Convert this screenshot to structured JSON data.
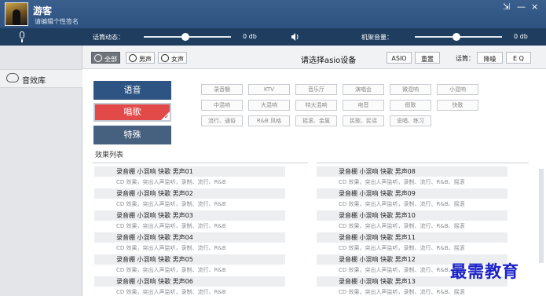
{
  "titlebar": {
    "username": "游客",
    "signature": "请编辑个性签名",
    "controls": {
      "shrink": "⇲",
      "minimize": "—",
      "close": "×"
    }
  },
  "controls": {
    "mic_label": "话筒动态：",
    "mic_value": "0 db",
    "mic_level": 0.48,
    "machine_label": "机架音量：",
    "machine_value": "0 db",
    "machine_level": 0.48
  },
  "sidebar": {
    "items": [
      {
        "label": "音效库",
        "icon": "cloud-icon"
      }
    ]
  },
  "filter": {
    "tabs": [
      {
        "label": "全部",
        "active": true
      },
      {
        "label": "男声",
        "active": false
      },
      {
        "label": "女声",
        "active": false
      }
    ],
    "prompt": "请选择asio设备",
    "asio_btn": "ASIO",
    "reset_btn": "重置",
    "mic_label": "话筒：",
    "noise_btn": "降噪",
    "eq_btn": "E Q"
  },
  "categories": [
    "语音",
    "唱歌",
    "特殊"
  ],
  "selected_category": "唱歌",
  "tags": [
    [
      "录音棚",
      "KTV",
      "音乐厅",
      "演唱会",
      "微混响",
      "小混响"
    ],
    [
      "中混响",
      "大混响",
      "特大混响",
      "电音",
      "假歌",
      "快歌"
    ],
    [
      "流行、通俗",
      "R&B 风格",
      "摇滚、金属",
      "民歌、民谣",
      "说唱、练习"
    ]
  ],
  "effects": {
    "title": "效果列表",
    "left": [
      {
        "title": "录音棚 小混响 快歌  男声01",
        "desc": "CD 效果，突出人声监听，录制、流行、R&B"
      },
      {
        "title": "录音棚 小混响 快歌  男声02",
        "desc": "CD 效果，突出人声监听，录制、流行、R&B"
      },
      {
        "title": "录音棚 小混响 快歌  男声03",
        "desc": "CD 效果，突出人声监听，录制、流行、R&B"
      },
      {
        "title": "录音棚 小混响 快歌  男声04",
        "desc": "CD 效果，突出人声监听，录制、流行、R&B"
      },
      {
        "title": "录音棚 小混响 快歌  男声05",
        "desc": "CD 效果，突出人声监听，录制、流行、R&B"
      },
      {
        "title": "录音棚 小混响 快歌  男声06",
        "desc": "CD 效果，突出人声监听，录制、流行、R&B"
      }
    ],
    "right": [
      {
        "title": "录音棚 小混响 快歌  男声08",
        "desc": "CD 效果，突出人声监听，录制、流行、R&B、摇滚"
      },
      {
        "title": "录音棚 小混响 快歌  男声09",
        "desc": "CD 效果，突出人声监听，录制、流行、R&B、摇滚"
      },
      {
        "title": "录音棚 小混响 快歌  男声10",
        "desc": "CD 效果，突出人声监听，录制、流行、R&B、摇滚"
      },
      {
        "title": "录音棚 小混响 快歌  男声11",
        "desc": "CD 效果，突出人声监听，录制、流行、R&B、摇滚"
      },
      {
        "title": "录音棚 小混响 快歌  男声12",
        "desc": "CD 效果，突出人声监听，录制、流行、R&B、摇滚"
      },
      {
        "title": "录音棚 小混响 快歌  男声13",
        "desc": "CD 效果，突出人声监听，录制、流行、R&B、摇滚"
      }
    ]
  },
  "watermark": "最需教育",
  "colors": {
    "titlebar": "#2d5280",
    "ctlbar": "#1f3d5f",
    "button": "#2d5483",
    "selected": "#e24a4a",
    "watermark": "#1b22c9"
  }
}
